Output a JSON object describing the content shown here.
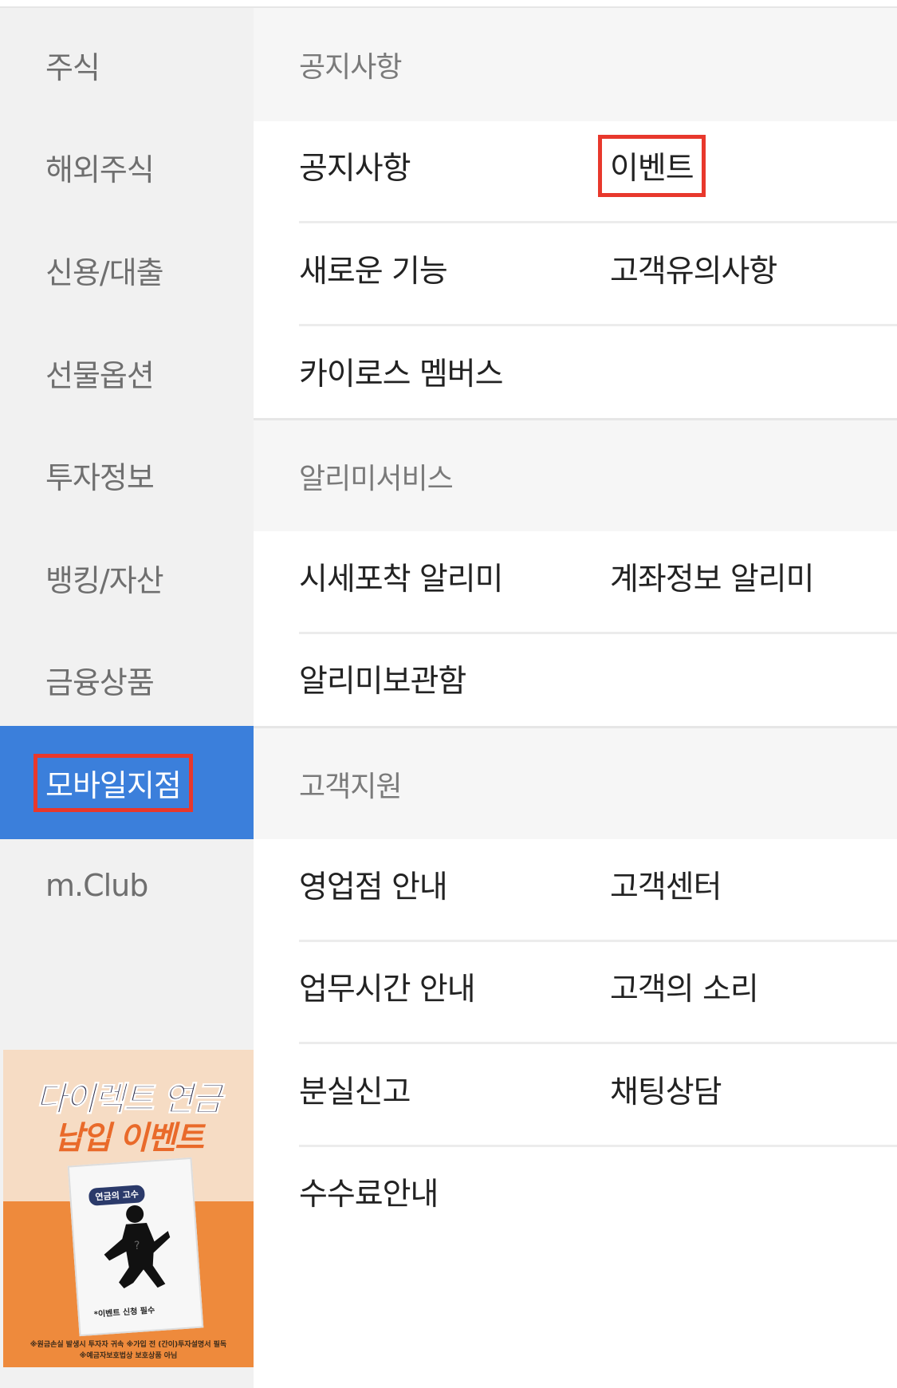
{
  "left_menu": {
    "items": [
      {
        "label": "주식"
      },
      {
        "label": "해외주식"
      },
      {
        "label": "신용/대출"
      },
      {
        "label": "선물옵션"
      },
      {
        "label": "투자정보"
      },
      {
        "label": "뱅킹/자산"
      },
      {
        "label": "금융상품"
      },
      {
        "label": "모바일지점",
        "active": true,
        "highlighted": true
      },
      {
        "label": "m.Club"
      }
    ],
    "active_color": "#3b7fdb"
  },
  "banner": {
    "title_line1": "다이렉트 연금",
    "title_line2": "납입 이벤트",
    "card_tag": "연금의 고수",
    "card_note": "*이벤트 신청 필수",
    "fine_print_1": "※원금손실 발생시 투자자 귀속 ※가입 전 (간이)투자설명서 필독",
    "fine_print_2": "※예금자보호법상 보호상품 아님"
  },
  "sections": [
    {
      "header": "공지사항",
      "rows": [
        {
          "left": "공지사항",
          "right": "이벤트",
          "right_highlighted": true
        },
        {
          "left": "새로운 기능",
          "right": "고객유의사항"
        },
        {
          "left": "카이로스 멤버스",
          "right": ""
        }
      ]
    },
    {
      "header": "알리미서비스",
      "rows": [
        {
          "left": "시세포착 알리미",
          "right": "계좌정보 알리미"
        },
        {
          "left": "알리미보관함",
          "right": ""
        }
      ]
    },
    {
      "header": "고객지원",
      "rows": [
        {
          "left": "영업점 안내",
          "right": "고객센터"
        },
        {
          "left": "업무시간 안내",
          "right": "고객의 소리"
        },
        {
          "left": "분실신고",
          "right": "채팅상담"
        },
        {
          "left": "수수료안내",
          "right": ""
        }
      ]
    }
  ],
  "highlight_color": "#e8382c"
}
